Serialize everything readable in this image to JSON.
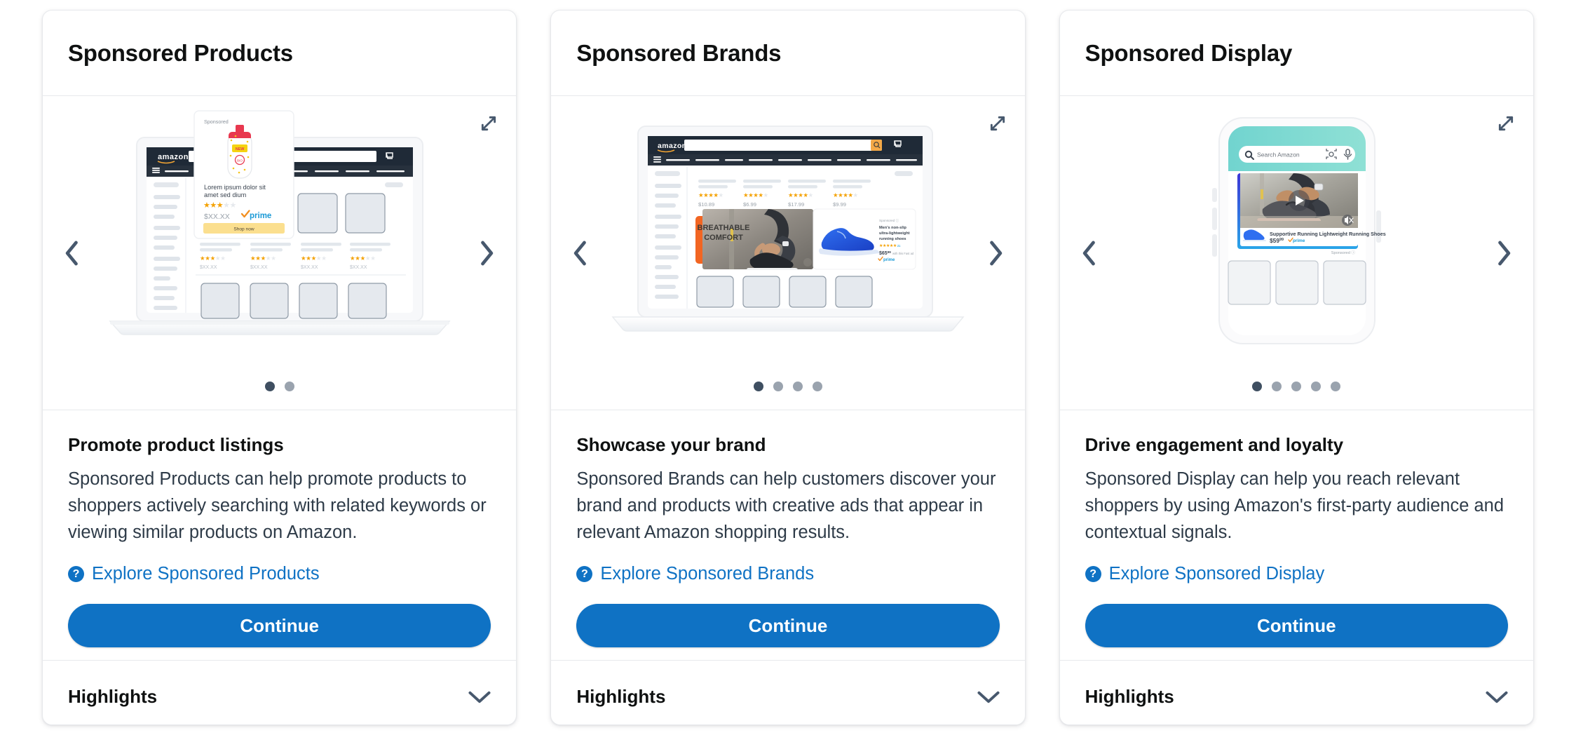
{
  "theme": {
    "accent": "#0f72c4",
    "text_dark": "#0f1111",
    "text_body": "#2e3b48",
    "border": "#e7e9ec",
    "dot_active": "#3f4f61",
    "dot_idle": "#9aa3ae",
    "star_gold": "#f4a100",
    "prime_blue": "#1b9ad6",
    "shop_now_yellow": "#fbdf8f",
    "orange": "#f26522"
  },
  "cards": [
    {
      "title": "Sponsored Products",
      "subtitle": "Promote product listings",
      "description": "Sponsored Products can help promote products to shoppers actively searching with related keywords or viewing similar products on Amazon.",
      "explore_label": "Explore Sponsored Products",
      "continue_label": "Continue",
      "highlights_label": "Highlights",
      "carousel": {
        "total": 2,
        "active": 1
      },
      "illustration": {
        "kind": "laptop-search-results",
        "brand": "amazon",
        "ad_card": {
          "badge": "Sponsored",
          "product_title": "Lorem ipsum dolor sit amet sed dium",
          "rating": 3,
          "rating_max": 5,
          "price": "$XX.XX",
          "prime_label": "prime",
          "cta": "Shop now"
        },
        "result_rows": [
          {
            "rating": 3,
            "price": "$XX.XX"
          },
          {
            "rating": 3,
            "price": "$XX.XX"
          },
          {
            "rating": 3,
            "price": "$XX.XX"
          },
          {
            "rating": 3,
            "price": "$XX.XX"
          }
        ]
      }
    },
    {
      "title": "Sponsored Brands",
      "subtitle": "Showcase your brand",
      "description": "Sponsored Brands can help customers discover your brand and products with creative ads that appear in relevant Amazon shopping results.",
      "explore_label": "Explore Sponsored Brands",
      "continue_label": "Continue",
      "highlights_label": "Highlights",
      "carousel": {
        "total": 4,
        "active": 1
      },
      "illustration": {
        "kind": "laptop-brand-banner",
        "brand": "amazon",
        "banner_headline_line1": "BREATHABLE",
        "banner_headline_line2": "COMFORT",
        "side_panel": {
          "badge": "Sponsored",
          "product_title": "Men's non-slip ultra-lightweight running shoes",
          "rating": 5,
          "review_count": "21",
          "price": "$65",
          "price_cents": "99",
          "shipping_note": "with this Fast ad",
          "prime_label": "prime"
        },
        "result_prices": [
          "$10.89",
          "$6.99",
          "$17.99",
          "$9.99"
        ],
        "result_ratings": [
          4,
          4,
          4,
          4
        ]
      }
    },
    {
      "title": "Sponsored Display",
      "subtitle": "Drive engagement and loyalty",
      "description": "Sponsored Display can help you reach relevant shoppers by using Amazon's first-party audience and contextual signals.",
      "explore_label": "Explore Sponsored Display",
      "continue_label": "Continue",
      "highlights_label": "Highlights",
      "carousel": {
        "total": 5,
        "active": 1
      },
      "illustration": {
        "kind": "phone-video-ad",
        "search_placeholder": "Search Amazon",
        "ad": {
          "product_title": "Supportive Running Lightweight Running Shoes",
          "price_dollars": "$59",
          "price_cents": "99",
          "prime_label": "prime",
          "sponsored_label": "Sponsored"
        }
      }
    }
  ],
  "icons": {
    "prev": "chevron-left-icon",
    "next": "chevron-right-icon",
    "expand": "expand-icon",
    "collapse_toggle": "chevron-down-icon",
    "help": "help-circle-icon",
    "search": "search-icon",
    "mic": "microphone-icon",
    "camera": "camera-lens-icon",
    "play": "play-icon",
    "mute": "mute-icon",
    "cart": "cart-icon",
    "menu": "hamburger-menu-icon"
  }
}
